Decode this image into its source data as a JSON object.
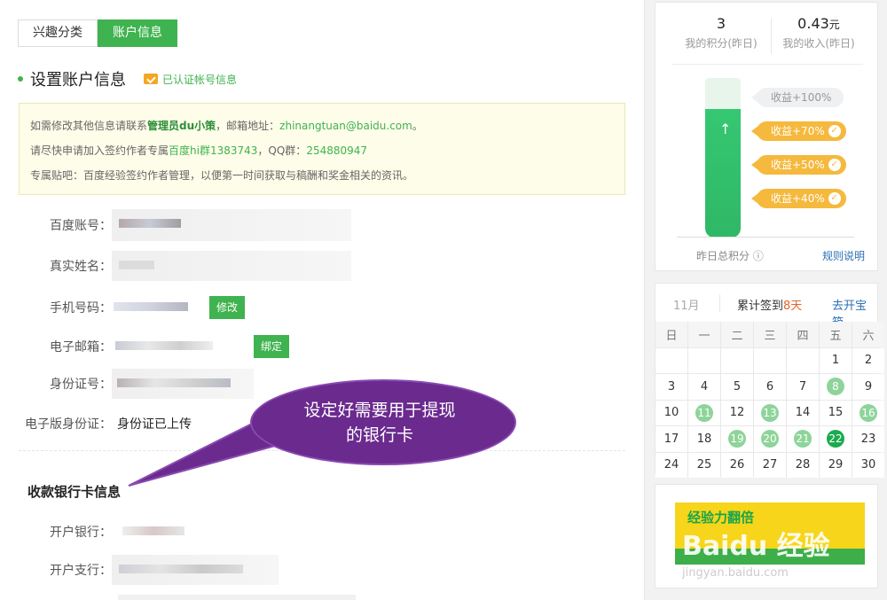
{
  "tabs": [
    {
      "label": "兴趣分类"
    },
    {
      "label": "账户信息"
    }
  ],
  "section": {
    "title": "设置账户信息",
    "verified": "已认证帐号信息"
  },
  "notice": {
    "l1_a": "如需修改其他信息请联系",
    "l1_b": "管理员du小策",
    "l1_c": "，邮箱地址：",
    "l1_d": "zhinangtuan@baidu.com",
    "l1_e": "。",
    "l2_a": "请尽快申请加入签约作者专属",
    "l2_b": "百度hi群1383743",
    "l2_c": "，QQ群：",
    "l2_d": "254880947",
    "l3": "专属贴吧：百度经验签约作者管理，以便第一时间获取与稿酬和奖金相关的资讯。"
  },
  "fields": {
    "baidu_account": "百度账号：",
    "real_name": "真实姓名：",
    "phone": "手机号码：",
    "phone_btn": "修改",
    "email": "电子邮箱：",
    "email_btn": "绑定",
    "id_number": "身份证号：",
    "id_image": "电子版身份证：",
    "id_image_value": "身份证已上传"
  },
  "bank": {
    "title": "收款银行卡信息",
    "bank_name": "开户银行：",
    "branch": "开户支行："
  },
  "callout": {
    "line1": "设定好需要用于提现",
    "line2": "的银行卡"
  },
  "stats": {
    "points_value": "3",
    "points_caption": "我的积分(昨日)",
    "income_value": "0.43",
    "income_unit": "元",
    "income_caption": "我的收入(昨日)",
    "tags": [
      "收益+100%",
      "收益+70%",
      "收益+50%",
      "收益+40%"
    ],
    "total_label": "昨日总积分 ⓘ",
    "rules_link": "规则说明"
  },
  "calendar": {
    "month": "11月",
    "signed_prefix": "累计签到",
    "signed_count": "8天",
    "treasure_link": "去开宝箱",
    "weekdays": [
      "日",
      "一",
      "二",
      "三",
      "四",
      "五",
      "六"
    ],
    "days": [
      "",
      "",
      "",
      "",
      "",
      "1",
      "2",
      "3",
      "4",
      "5",
      "6",
      "7",
      "8",
      "9",
      "10",
      "11",
      "12",
      "13",
      "14",
      "15",
      "16",
      "17",
      "18",
      "19",
      "20",
      "21",
      "22",
      "23",
      "24",
      "25",
      "26",
      "27",
      "28",
      "29",
      "30"
    ],
    "checked": [
      "8",
      "11",
      "13",
      "16",
      "19",
      "20",
      "21"
    ],
    "today": "22"
  },
  "banner": {
    "text": "经验力翻倍"
  },
  "watermark": {
    "logo": "Baidu 经验",
    "url": "jingyan.baidu.com"
  },
  "colors": {
    "accent": "#3fb34f",
    "callout": "#6a2a8e",
    "gold": "#f5b93d"
  }
}
